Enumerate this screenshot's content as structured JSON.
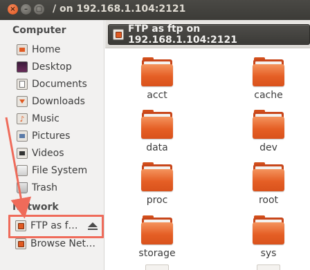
{
  "window": {
    "title": "/ on 192.168.1.104:2121",
    "controls": {
      "close": "×",
      "minimize": "–",
      "maximize": "▢"
    }
  },
  "sidebar": {
    "sections": [
      {
        "title": "Computer",
        "items": [
          {
            "label": "Home",
            "icon": "home-folder-icon"
          },
          {
            "label": "Desktop",
            "icon": "desktop-icon"
          },
          {
            "label": "Documents",
            "icon": "documents-folder-icon"
          },
          {
            "label": "Downloads",
            "icon": "downloads-folder-icon"
          },
          {
            "label": "Music",
            "icon": "music-folder-icon"
          },
          {
            "label": "Pictures",
            "icon": "pictures-folder-icon"
          },
          {
            "label": "Videos",
            "icon": "videos-folder-icon"
          },
          {
            "label": "File System",
            "icon": "file-system-icon"
          },
          {
            "label": "Trash",
            "icon": "trash-icon"
          }
        ]
      },
      {
        "title": "Network",
        "items": [
          {
            "label": "FTP as f…",
            "icon": "ftp-share-icon"
          },
          {
            "label": "Browse Net…",
            "icon": "network-icon"
          }
        ]
      }
    ]
  },
  "pathbar": {
    "label": "FTP as ftp on 192.168.1.104:2121",
    "icon": "ftp-share-icon"
  },
  "folders": [
    {
      "name": "acct"
    },
    {
      "name": "cache"
    },
    {
      "name": "data"
    },
    {
      "name": "dev"
    },
    {
      "name": "proc"
    },
    {
      "name": "root"
    },
    {
      "name": "storage"
    },
    {
      "name": "sys"
    }
  ],
  "annotation": {
    "color": "#ef6b5a"
  },
  "colors": {
    "accent": "#e55f25",
    "titlebar": "#3c3b37",
    "sidebar": "#f2f1f0"
  }
}
